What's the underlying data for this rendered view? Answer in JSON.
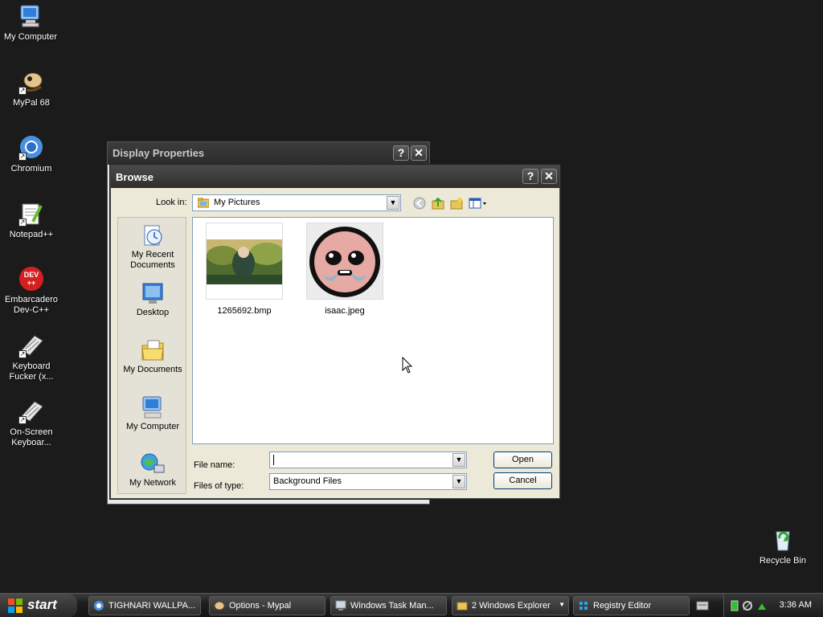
{
  "desktop": {
    "icons": [
      {
        "label": "My Computer",
        "icon": "my-computer-icon"
      },
      {
        "label": "MyPal 68",
        "icon": "mypal-icon"
      },
      {
        "label": "Chromium",
        "icon": "chromium-icon"
      },
      {
        "label": "Notepad++",
        "icon": "notepad-plus-plus-icon"
      },
      {
        "label": "Embarcadero Dev-C++",
        "icon": "devcpp-icon"
      },
      {
        "label": "Keyboard Fucker (x...",
        "icon": "keyboard-icon"
      },
      {
        "label": "On-Screen Keyboar...",
        "icon": "onscreen-keyboard-icon"
      },
      {
        "label": "Recycle Bin",
        "icon": "recycle-bin-icon"
      }
    ],
    "devcpp_badge": "DEV\n++"
  },
  "display_properties": {
    "title": "Display Properties",
    "help": "?",
    "close": "✕"
  },
  "browse": {
    "title": "Browse",
    "help": "?",
    "close": "✕",
    "look_in_label": "Look in:",
    "look_in_value": "My Pictures",
    "places": [
      {
        "label": "My Recent Documents",
        "icon": "recent-documents-icon"
      },
      {
        "label": "Desktop",
        "icon": "desktop-icon"
      },
      {
        "label": "My Documents",
        "icon": "my-documents-icon"
      },
      {
        "label": "My Computer",
        "icon": "my-computer-icon"
      },
      {
        "label": "My Network",
        "icon": "network-icon"
      }
    ],
    "files": [
      {
        "name": "1265692.bmp"
      },
      {
        "name": "isaac.jpeg"
      }
    ],
    "file_name_label": "File name:",
    "file_name_value": "",
    "file_type_label": "Files of type:",
    "file_type_value": "Background Files",
    "open_label": "Open",
    "cancel_label": "Cancel"
  },
  "taskbar": {
    "start_label": "start",
    "tasks": [
      {
        "label": "TIGHNARI WALLPA...",
        "icon": "chromium-icon"
      },
      {
        "label": "Options - Mypal",
        "icon": "mypal-icon"
      },
      {
        "label": "Windows Task Man...",
        "icon": "task-manager-icon"
      },
      {
        "label": "2 Windows Explorer",
        "icon": "folder-icon"
      },
      {
        "label": "Registry Editor",
        "icon": "registry-editor-icon"
      }
    ],
    "clock": "3:36 AM"
  }
}
